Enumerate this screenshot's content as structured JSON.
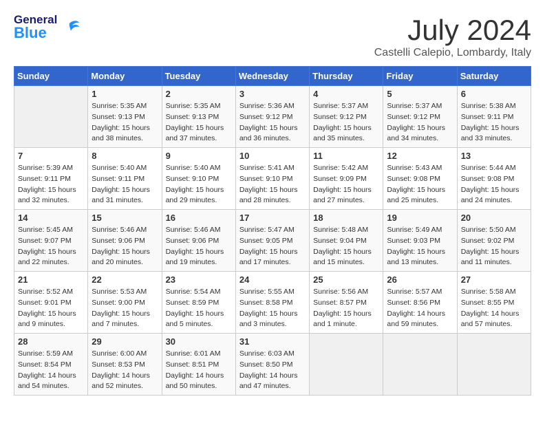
{
  "header": {
    "logo_general": "General",
    "logo_blue": "Blue",
    "title": "July 2024",
    "location": "Castelli Calepio, Lombardy, Italy"
  },
  "days_of_week": [
    "Sunday",
    "Monday",
    "Tuesday",
    "Wednesday",
    "Thursday",
    "Friday",
    "Saturday"
  ],
  "weeks": [
    [
      {
        "day": "",
        "info": ""
      },
      {
        "day": "1",
        "info": "Sunrise: 5:35 AM\nSunset: 9:13 PM\nDaylight: 15 hours\nand 38 minutes."
      },
      {
        "day": "2",
        "info": "Sunrise: 5:35 AM\nSunset: 9:13 PM\nDaylight: 15 hours\nand 37 minutes."
      },
      {
        "day": "3",
        "info": "Sunrise: 5:36 AM\nSunset: 9:12 PM\nDaylight: 15 hours\nand 36 minutes."
      },
      {
        "day": "4",
        "info": "Sunrise: 5:37 AM\nSunset: 9:12 PM\nDaylight: 15 hours\nand 35 minutes."
      },
      {
        "day": "5",
        "info": "Sunrise: 5:37 AM\nSunset: 9:12 PM\nDaylight: 15 hours\nand 34 minutes."
      },
      {
        "day": "6",
        "info": "Sunrise: 5:38 AM\nSunset: 9:11 PM\nDaylight: 15 hours\nand 33 minutes."
      }
    ],
    [
      {
        "day": "7",
        "info": "Sunrise: 5:39 AM\nSunset: 9:11 PM\nDaylight: 15 hours\nand 32 minutes."
      },
      {
        "day": "8",
        "info": "Sunrise: 5:40 AM\nSunset: 9:11 PM\nDaylight: 15 hours\nand 31 minutes."
      },
      {
        "day": "9",
        "info": "Sunrise: 5:40 AM\nSunset: 9:10 PM\nDaylight: 15 hours\nand 29 minutes."
      },
      {
        "day": "10",
        "info": "Sunrise: 5:41 AM\nSunset: 9:10 PM\nDaylight: 15 hours\nand 28 minutes."
      },
      {
        "day": "11",
        "info": "Sunrise: 5:42 AM\nSunset: 9:09 PM\nDaylight: 15 hours\nand 27 minutes."
      },
      {
        "day": "12",
        "info": "Sunrise: 5:43 AM\nSunset: 9:08 PM\nDaylight: 15 hours\nand 25 minutes."
      },
      {
        "day": "13",
        "info": "Sunrise: 5:44 AM\nSunset: 9:08 PM\nDaylight: 15 hours\nand 24 minutes."
      }
    ],
    [
      {
        "day": "14",
        "info": "Sunrise: 5:45 AM\nSunset: 9:07 PM\nDaylight: 15 hours\nand 22 minutes."
      },
      {
        "day": "15",
        "info": "Sunrise: 5:46 AM\nSunset: 9:06 PM\nDaylight: 15 hours\nand 20 minutes."
      },
      {
        "day": "16",
        "info": "Sunrise: 5:46 AM\nSunset: 9:06 PM\nDaylight: 15 hours\nand 19 minutes."
      },
      {
        "day": "17",
        "info": "Sunrise: 5:47 AM\nSunset: 9:05 PM\nDaylight: 15 hours\nand 17 minutes."
      },
      {
        "day": "18",
        "info": "Sunrise: 5:48 AM\nSunset: 9:04 PM\nDaylight: 15 hours\nand 15 minutes."
      },
      {
        "day": "19",
        "info": "Sunrise: 5:49 AM\nSunset: 9:03 PM\nDaylight: 15 hours\nand 13 minutes."
      },
      {
        "day": "20",
        "info": "Sunrise: 5:50 AM\nSunset: 9:02 PM\nDaylight: 15 hours\nand 11 minutes."
      }
    ],
    [
      {
        "day": "21",
        "info": "Sunrise: 5:52 AM\nSunset: 9:01 PM\nDaylight: 15 hours\nand 9 minutes."
      },
      {
        "day": "22",
        "info": "Sunrise: 5:53 AM\nSunset: 9:00 PM\nDaylight: 15 hours\nand 7 minutes."
      },
      {
        "day": "23",
        "info": "Sunrise: 5:54 AM\nSunset: 8:59 PM\nDaylight: 15 hours\nand 5 minutes."
      },
      {
        "day": "24",
        "info": "Sunrise: 5:55 AM\nSunset: 8:58 PM\nDaylight: 15 hours\nand 3 minutes."
      },
      {
        "day": "25",
        "info": "Sunrise: 5:56 AM\nSunset: 8:57 PM\nDaylight: 15 hours\nand 1 minute."
      },
      {
        "day": "26",
        "info": "Sunrise: 5:57 AM\nSunset: 8:56 PM\nDaylight: 14 hours\nand 59 minutes."
      },
      {
        "day": "27",
        "info": "Sunrise: 5:58 AM\nSunset: 8:55 PM\nDaylight: 14 hours\nand 57 minutes."
      }
    ],
    [
      {
        "day": "28",
        "info": "Sunrise: 5:59 AM\nSunset: 8:54 PM\nDaylight: 14 hours\nand 54 minutes."
      },
      {
        "day": "29",
        "info": "Sunrise: 6:00 AM\nSunset: 8:53 PM\nDaylight: 14 hours\nand 52 minutes."
      },
      {
        "day": "30",
        "info": "Sunrise: 6:01 AM\nSunset: 8:51 PM\nDaylight: 14 hours\nand 50 minutes."
      },
      {
        "day": "31",
        "info": "Sunrise: 6:03 AM\nSunset: 8:50 PM\nDaylight: 14 hours\nand 47 minutes."
      },
      {
        "day": "",
        "info": ""
      },
      {
        "day": "",
        "info": ""
      },
      {
        "day": "",
        "info": ""
      }
    ]
  ]
}
